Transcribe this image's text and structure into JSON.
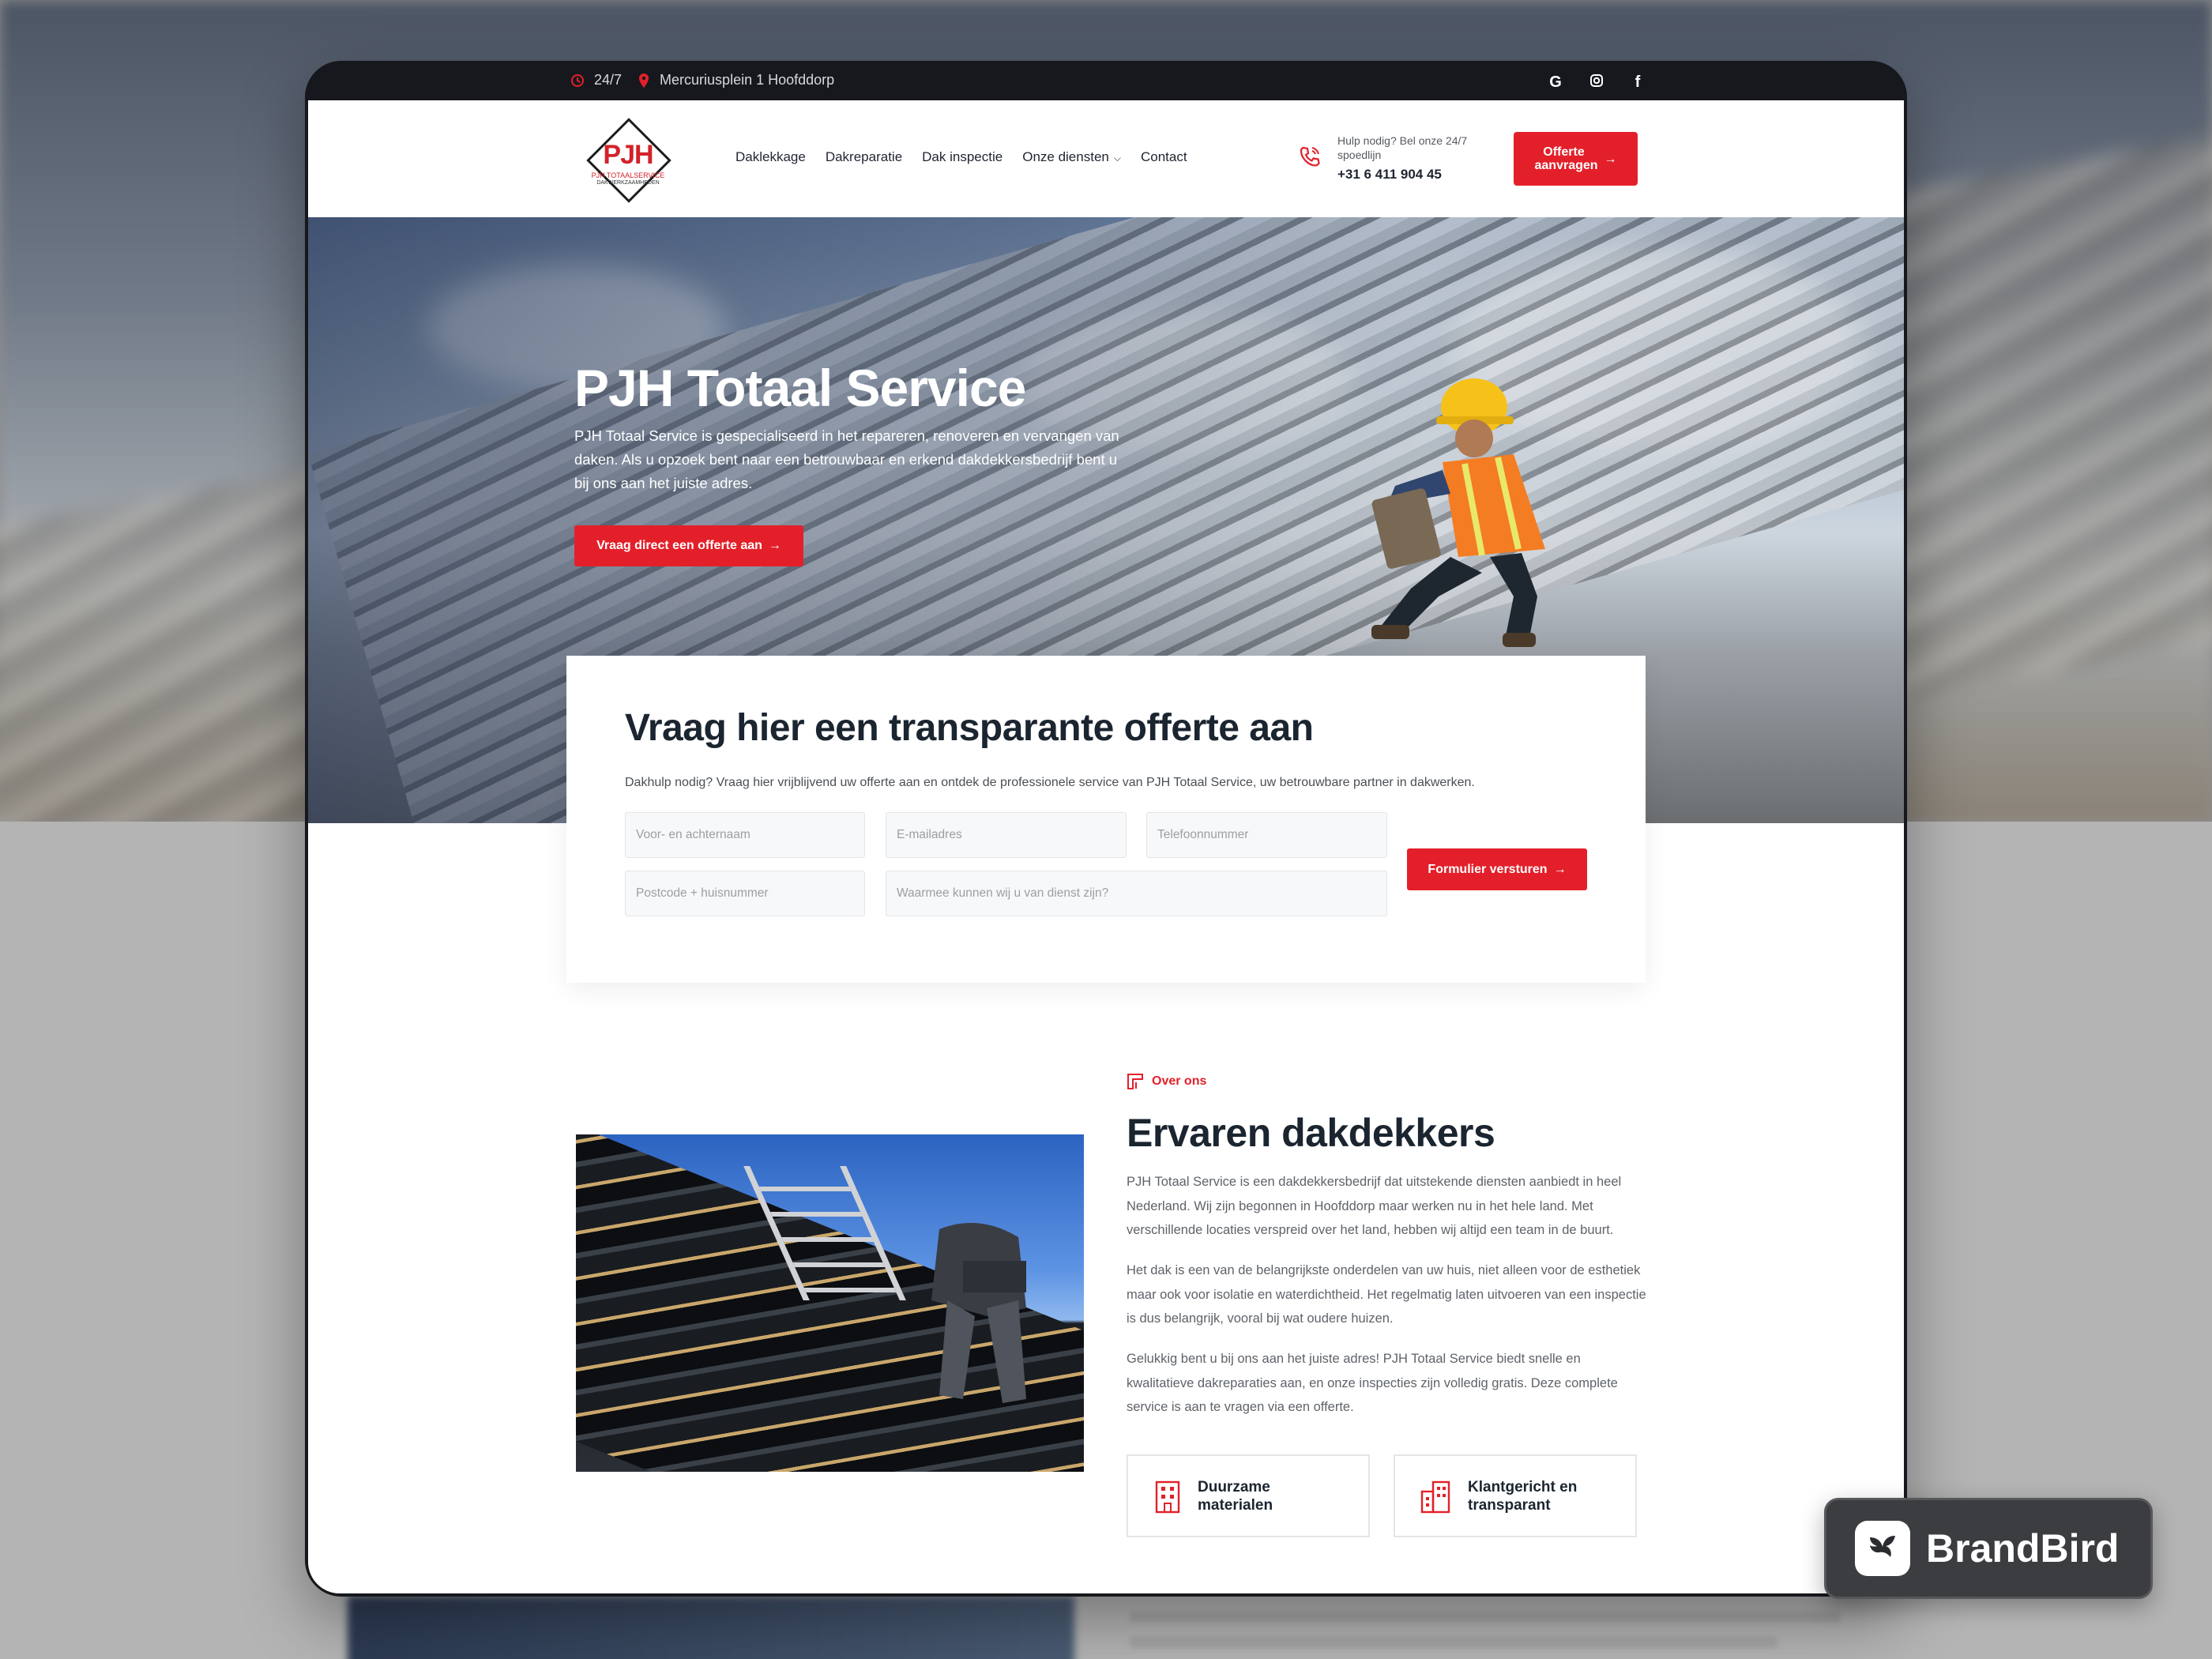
{
  "topbar": {
    "hours": "24/7",
    "address": "Mercuriusplein 1 Hoofddorp",
    "social": [
      "google-icon",
      "instagram-icon",
      "facebook-icon"
    ]
  },
  "header": {
    "logo": {
      "mark": "PJH",
      "name": "PJH TOTAALSERVICE",
      "tagline": "DAKWERKZAAMHEDEN"
    },
    "nav": [
      "Daklekkage",
      "Dakreparatie",
      "Dak inspectie",
      "Onze diensten",
      "Contact"
    ],
    "help_text": "Hulp nodig? Bel onze 24/7 spoedlijn",
    "phone": "+31 6 411 904 45",
    "quote_button": "Offerte aanvragen"
  },
  "hero": {
    "title": "PJH Totaal Service",
    "text": "PJH Totaal Service is gespecialiseerd in het repareren, renoveren en vervangen van daken. Als u opzoek bent naar een betrouwbaar en erkend dakdekkersbedrijf bent u bij ons aan het juiste adres.",
    "button": "Vraag direct een offerte aan"
  },
  "quote_form": {
    "title": "Vraag hier een transparante offerte aan",
    "subtitle": "Dakhulp nodig? Vraag hier vrijblijvend uw offerte aan en ontdek de professionele service van PJH Totaal Service, uw betrouwbare partner in dakwerken.",
    "fields": {
      "name": "Voor- en achternaam",
      "email": "E-mailadres",
      "phone": "Telefoonnummer",
      "postcode": "Postcode + huisnummer",
      "message": "Waarmee kunnen wij u van dienst zijn?"
    },
    "submit": "Formulier versturen"
  },
  "about": {
    "tag": "Over ons",
    "title": "Ervaren dakdekkers",
    "paragraphs": [
      "PJH Totaal Service is een dakdekkersbedrijf dat uitstekende diensten aanbiedt in heel Nederland. Wij zijn begonnen in Hoofddorp maar werken nu in het hele land. Met verschillende locaties verspreid over het land, hebben wij altijd een team in de buurt.",
      "Het dak is een van de belangrijkste onderdelen van uw huis, niet alleen voor de esthetiek maar ook voor isolatie en waterdichtheid. Het regelmatig laten uitvoeren van een inspectie is dus belangrijk, vooral bij wat oudere huizen.",
      "Gelukkig bent u bij ons aan het juiste adres! PJH Totaal Service biedt snelle en kwalitatieve dakreparaties aan, en onze inspecties zijn volledig gratis. Deze complete service is aan te vragen via een offerte."
    ],
    "features": [
      "Duurzame materialen",
      "Klantgericht en transparant"
    ]
  },
  "badge": {
    "label": "BrandBird"
  },
  "colors": {
    "accent": "#e3202a",
    "dark": "#1b2530",
    "frame": "#17181d"
  }
}
